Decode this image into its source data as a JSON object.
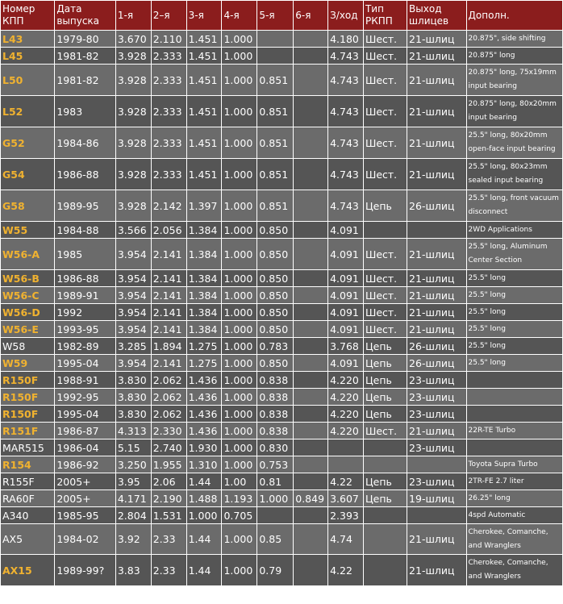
{
  "header": {
    "col_model": "Номер КПП",
    "col_years": "Дата выпуска",
    "col_g1": "1-я",
    "col_g2": "2–я",
    "col_g3": "3-я",
    "col_g4": "4-я",
    "col_g5": "5-я",
    "col_g6": "6-я",
    "col_rev": "З/ход",
    "col_type": "Тип РКПП",
    "col_output": "Выход шлицев",
    "col_notes": "Дополн."
  },
  "colors": {
    "header_bg": "#8b1d1d",
    "row_light": "#6b6b6b",
    "row_dark": "#555555",
    "model_highlight": "#f0b230"
  },
  "rows": [
    {
      "model": "L43",
      "years": "1979-80",
      "g1": "3.670",
      "g2": "2.110",
      "g3": "1.451",
      "g4": "1.000",
      "g5": "",
      "g6": "",
      "rev": "4.180",
      "type": "Шест.",
      "output": "21-шлиц",
      "notes": "20.875\", side shifting"
    },
    {
      "model": "L45",
      "years": "1981-82",
      "g1": "3.928",
      "g2": "2.333",
      "g3": "1.451",
      "g4": "1.000",
      "g5": "",
      "g6": "",
      "rev": "4.743",
      "type": "Шест.",
      "output": "21-шлиц",
      "notes": "20.875\" long"
    },
    {
      "model": "L50",
      "years": "1981-82",
      "g1": "3.928",
      "g2": "2.333",
      "g3": "1.451",
      "g4": "1.000",
      "g5": "0.851",
      "g6": "",
      "rev": "4.743",
      "type": "Шест.",
      "output": "21-шлиц",
      "notes": "20.875\" long, 75x19mm input bearing"
    },
    {
      "model": "L52",
      "years": "1983",
      "g1": "3.928",
      "g2": "2.333",
      "g3": "1.451",
      "g4": "1.000",
      "g5": "0.851",
      "g6": "",
      "rev": "4.743",
      "type": "Шест.",
      "output": "21-шлиц",
      "notes": "20.875\" long, 80x20mm input bearing"
    },
    {
      "model": "G52",
      "years": "1984-86",
      "g1": "3.928",
      "g2": "2.333",
      "g3": "1.451",
      "g4": "1.000",
      "g5": "0.851",
      "g6": "",
      "rev": "4.743",
      "type": "Шест.",
      "output": "21-шлиц",
      "notes": "25.5\" long, 80x20mm open-face input bearing"
    },
    {
      "model": "G54",
      "years": "1986-88",
      "g1": "3.928",
      "g2": "2.333",
      "g3": "1.451",
      "g4": "1.000",
      "g5": "0.851",
      "g6": "",
      "rev": "4.743",
      "type": "Шест.",
      "output": "21-шлиц",
      "notes": "25.5\" long, 80x23mm sealed input bearing"
    },
    {
      "model": "G58",
      "years": "1989-95",
      "g1": "3.928",
      "g2": "2.142",
      "g3": "1.397",
      "g4": "1.000",
      "g5": "0.851",
      "g6": "",
      "rev": "4.743",
      "type": "Цепь",
      "output": "26-шлиц",
      "notes": "25.5\" long, front vacuum disconnect"
    },
    {
      "model": "W55",
      "years": "1984-88",
      "g1": "3.566",
      "g2": "2.056",
      "g3": "1.384",
      "g4": "1.000",
      "g5": "0.850",
      "g6": "",
      "rev": "4.091",
      "type": "",
      "output": "",
      "notes": "2WD Applications"
    },
    {
      "model": "W56-A",
      "years": "1985",
      "g1": "3.954",
      "g2": "2.141",
      "g3": "1.384",
      "g4": "1.000",
      "g5": "0.850",
      "g6": "",
      "rev": "4.091",
      "type": "Шест.",
      "output": "21-шлиц",
      "notes": "25.5\" long, Aluminum Center Section"
    },
    {
      "model": "W56-B",
      "years": "1986-88",
      "g1": "3.954",
      "g2": "2.141",
      "g3": "1.384",
      "g4": "1.000",
      "g5": "0.850",
      "g6": "",
      "rev": "4.091",
      "type": "Шест.",
      "output": "21-шлиц",
      "notes": "25.5\" long"
    },
    {
      "model": "W56-C",
      "years": "1989-91",
      "g1": "3.954",
      "g2": "2.141",
      "g3": "1.384",
      "g4": "1.000",
      "g5": "0.850",
      "g6": "",
      "rev": "4.091",
      "type": "Шест.",
      "output": "21-шлиц",
      "notes": "25.5\" long"
    },
    {
      "model": "W56-D",
      "years": "1992",
      "g1": "3.954",
      "g2": "2.141",
      "g3": "1.384",
      "g4": "1.000",
      "g5": "0.850",
      "g6": "",
      "rev": "4.091",
      "type": "Шест.",
      "output": "21-шлиц",
      "notes": "25.5\" long"
    },
    {
      "model": "W56-E",
      "years": "1993-95",
      "g1": "3.954",
      "g2": "2.141",
      "g3": "1.384",
      "g4": "1.000",
      "g5": "0.850",
      "g6": "",
      "rev": "4.091",
      "type": "Шест.",
      "output": "21-шлиц",
      "notes": "25.5\" long"
    },
    {
      "model": "W58",
      "years": "1982-89",
      "g1": "3.285",
      "g2": "1.894",
      "g3": "1.275",
      "g4": "1.000",
      "g5": "0.783",
      "g6": "",
      "rev": "3.768",
      "type": "Цепь",
      "output": "26-шлиц",
      "notes": "25.5\" long"
    },
    {
      "model": "W59",
      "years": "1995-04",
      "g1": "3.954",
      "g2": "2.141",
      "g3": "1.275",
      "g4": "1.000",
      "g5": "0.850",
      "g6": "",
      "rev": "4.091",
      "type": "Цепь",
      "output": "26-шлиц",
      "notes": "25.5\" long"
    },
    {
      "model": "R150F",
      "years": "1988-91",
      "g1": "3.830",
      "g2": "2.062",
      "g3": "1.436",
      "g4": "1.000",
      "g5": "0.838",
      "g6": "",
      "rev": "4.220",
      "type": "Цепь",
      "output": "23-шлиц",
      "notes": ""
    },
    {
      "model": "R150F",
      "years": "1992-95",
      "g1": "3.830",
      "g2": "2.062",
      "g3": "1.436",
      "g4": "1.000",
      "g5": "0.838",
      "g6": "",
      "rev": "4.220",
      "type": "Цепь",
      "output": "23-шлиц",
      "notes": ""
    },
    {
      "model": "R150F",
      "years": "1995-04",
      "g1": "3.830",
      "g2": "2.062",
      "g3": "1.436",
      "g4": "1.000",
      "g5": "0.838",
      "g6": "",
      "rev": "4.220",
      "type": "Цепь",
      "output": "23-шлиц",
      "notes": ""
    },
    {
      "model": "R151F",
      "years": "1986-87",
      "g1": "4.313",
      "g2": "2.330",
      "g3": "1.436",
      "g4": "1.000",
      "g5": "0.838",
      "g6": "",
      "rev": "4.220",
      "type": "Шест.",
      "output": "21-шлиц",
      "notes": "22R-TE Turbo"
    },
    {
      "model": "MAR515",
      "years": "1986-04",
      "g1": "5.15",
      "g2": "2.740",
      "g3": "1.930",
      "g4": "1.000",
      "g5": "0.830",
      "g6": "",
      "rev": "",
      "type": "",
      "output": "23-шлиц",
      "notes": ""
    },
    {
      "model": "R154",
      "years": "1986-92",
      "g1": "3.250",
      "g2": "1.955",
      "g3": "1.310",
      "g4": "1.000",
      "g5": "0.753",
      "g6": "",
      "rev": "",
      "type": "",
      "output": "",
      "notes": "Toyota Supra Turbo"
    },
    {
      "model": "R155F",
      "years": "2005+",
      "g1": "3.95",
      "g2": "2.06",
      "g3": "1.44",
      "g4": "1.00",
      "g5": "0.81",
      "g6": "",
      "rev": "4.22",
      "type": "Цепь",
      "output": "23-шлиц",
      "notes": "2TR-FE 2.7 liter"
    },
    {
      "model": "RA60F",
      "years": "2005+",
      "g1": "4.171",
      "g2": "2.190",
      "g3": "1.488",
      "g4": "1.193",
      "g5": "1.000",
      "g6": "0.849",
      "rev": "3.607",
      "type": "Цепь",
      "output": "19-шлиц",
      "notes": "26.25\" long"
    },
    {
      "model": "A340",
      "years": "1985-95",
      "g1": "2.804",
      "g2": "1.531",
      "g3": "1.000",
      "g4": "0.705",
      "g5": "",
      "g6": "",
      "rev": "2.393",
      "type": "",
      "output": "",
      "notes": "4spd Automatic"
    },
    {
      "model": "AX5",
      "years": "1984-02",
      "g1": "3.92",
      "g2": "2.33",
      "g3": "1.44",
      "g4": "1.000",
      "g5": "0.85",
      "g6": "",
      "rev": "4.74",
      "type": "",
      "output": "21-шлиц",
      "notes": "Cherokee, Comanche, and Wranglers"
    },
    {
      "model": "AX15",
      "years": "1989-99?",
      "g1": "3.83",
      "g2": "2.33",
      "g3": "1.44",
      "g4": "1.000",
      "g5": "0.79",
      "g6": "",
      "rev": "4.22",
      "type": "",
      "output": "21-шлиц",
      "notes": "Cherokee, Comanche, and Wranglers"
    }
  ]
}
